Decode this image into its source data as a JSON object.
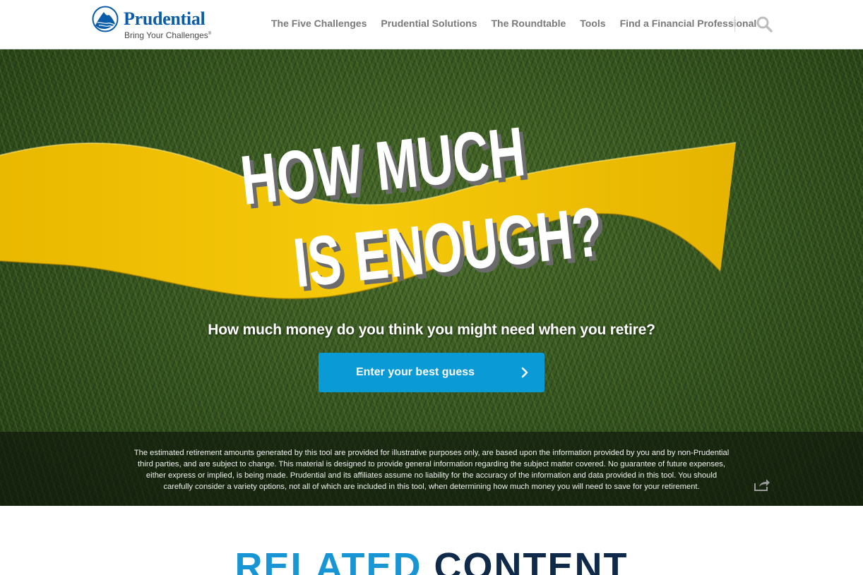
{
  "brand": {
    "name": "Prudential",
    "tagline": "Bring Your Challenges",
    "tagline_mark": "®",
    "blue": "#0a5ba8"
  },
  "nav": {
    "items": [
      {
        "label": "The Five Challenges"
      },
      {
        "label": "Prudential Solutions"
      },
      {
        "label": "The Roundtable"
      },
      {
        "label": "Tools"
      },
      {
        "label": "Find a Financial Professional"
      }
    ],
    "search_icon": "search-icon"
  },
  "hero": {
    "headline_line1": "HOW MUCH",
    "headline_line2": "IS ENOUGH?",
    "question": "How much money do you think you might need when you retire?",
    "cta_label": "Enter your best guess",
    "cta_icon": "chevron-right-icon",
    "cta_color": "#0a9ad6",
    "ribbon_color": "#f2c200",
    "disclaimer": "The estimated retirement amounts generated by this tool are provided for illustrative purposes only, are based upon the information provided by you and by non-Prudential third parties, and are subject to change. This material is designed to provide general information regarding the subject matter covered. No guarantee of future expenses, either express or implied, is being made. Prudential and its affiliates assume no liability for the accuracy of the information and data provided in this tool. You should carefully consider a variety options, not all of which are included in this tool, when determining how much money you will need to save for your retirement.",
    "share_icon": "share-icon"
  },
  "related": {
    "title_word1": "RELATED",
    "title_word2": "CONTENT",
    "accent": "#1795d4",
    "dark": "#0f2a4a"
  }
}
